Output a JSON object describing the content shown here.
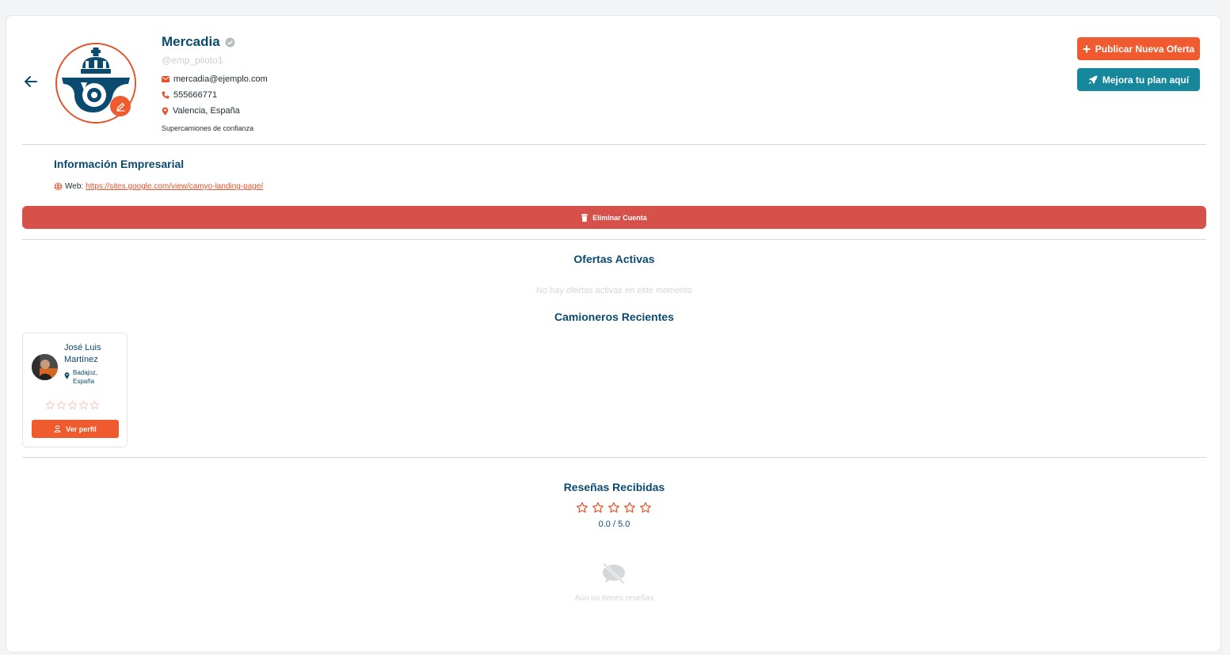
{
  "profile": {
    "name": "Mercadia",
    "handle": "@emp_piloto1",
    "email": "mercadia@ejemplo.com",
    "phone": "555666771",
    "location": "Valencia, España",
    "tagline": "Supercamiones de confianza",
    "icons": {
      "back": "arrow-left-icon",
      "verified": "verified-badge-icon",
      "edit": "pencil-icon",
      "email": "envelope-icon",
      "phone": "phone-icon",
      "location": "map-pin-icon"
    }
  },
  "actions": {
    "publish_label": "Publicar Nueva Oferta",
    "plan_label": "Mejora tu plan aquí",
    "delete_label": "Eliminar Cuenta"
  },
  "business": {
    "title": "Información Empresarial",
    "web_label": "Web:",
    "web_url": "https://sites.google.com/view/camyo-landing-page/"
  },
  "offers": {
    "title": "Ofertas Activas",
    "empty": "No hay ofertas activas en este momento"
  },
  "drivers": {
    "title": "Camioneros Recientes",
    "items": [
      {
        "name": "José Luis Martínez",
        "location": "Badajoz, España",
        "rating": 0,
        "button_label": "Ver perfil"
      }
    ]
  },
  "reviews": {
    "title": "Reseñas Recibidas",
    "rating": 0,
    "max_rating": 5,
    "score_text": "0.0 / 5.0",
    "empty": "Aún no tienes reseñas"
  },
  "colors": {
    "primary": "#ef5a2e",
    "teal": "#17879b",
    "danger": "#d5514a",
    "heading": "#0b4a6f"
  }
}
